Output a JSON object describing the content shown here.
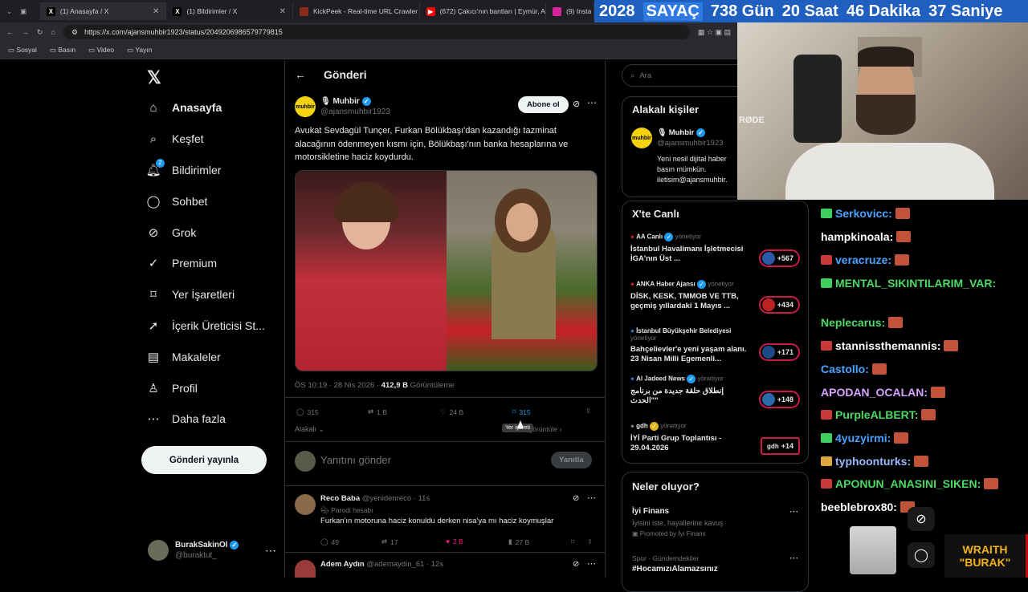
{
  "browser": {
    "tabs": [
      {
        "title": "(1) Anasayfa / X",
        "active": true
      },
      {
        "title": "(1) Bildirimler / X",
        "active": false
      },
      {
        "title": "KickPeek - Real-time URL Crawler",
        "active": false
      },
      {
        "title": "(672) Çakıcı'nın bantları | Eymür, A",
        "active": false
      },
      {
        "title": "(9) Insta",
        "active": false
      }
    ],
    "url": "https://x.com/ajansmuhbir1923/status/2049206986579779815",
    "bookmarks": [
      "Sosyal",
      "Basın",
      "Video",
      "Yayın"
    ]
  },
  "counter": {
    "year": "2028",
    "label": "SAYAÇ",
    "days": "738 Gün",
    "hours": "20 Saat",
    "minutes": "46 Dakika",
    "seconds": "37 Saniye"
  },
  "nav": {
    "items": [
      "Anasayfa",
      "Keşfet",
      "Bildirimler",
      "Sohbet",
      "Grok",
      "Premium",
      "Yer İşaretleri",
      "İçerik Üreticisi St...",
      "Makaleler",
      "Profil",
      "Daha fazla"
    ],
    "notif_badge": "2",
    "post_button": "Gönderi yayınla",
    "account_name": "BurakSakinOl",
    "account_handle": "@buraktut_"
  },
  "post": {
    "header": "Gönderi",
    "author_name": "Muhbir",
    "author_handle": "@ajansmuhbir1923",
    "subscribe": "Abone ol",
    "text": "Avukat Sevdagül Tunçer, Furkan Bölükbaşı'dan kazandığı tazminat alacağının ödenmeyen kısmı için, Bölükbaşı'nın banka hesaplarına ve motorsikletine haciz koydurdu.",
    "time": "ÖS 10:19 · 28 Nis 2026 · ",
    "views": "412,9 B",
    "views_label": "Görüntüleme",
    "replies": "315",
    "reposts": "1 B",
    "likes": "24 B",
    "bookmarks": "315",
    "tooltip": "Yer işareti",
    "relevant": "Alakalı",
    "quotes_link": "Alıntıları görüntüle",
    "reply_placeholder": "Yanıtını gönder",
    "reply_button": "Yanıtla"
  },
  "replies": [
    {
      "name": "Reco Baba",
      "handle": "@yenidenreco · 11s",
      "tag": "Parodi hesabı",
      "text": "Furkan'ın motoruna haciz konuldu derken nisa'ya mı haciz koymuşlar",
      "replies": "49",
      "reposts": "17",
      "likes": "2 B",
      "views": "27 B"
    },
    {
      "name": "Adem Aydın",
      "handle": "@ademaydin_61 · 12s"
    }
  ],
  "right": {
    "search_placeholder": "Ara",
    "people_title": "Alakalı kişiler",
    "person_name": "Muhbir",
    "person_handle": "@ajansmuhbir1923",
    "person_bio": "Yeni nesil dijital haber basın mümkün. iletisim@ajansmuhbir.",
    "live_title": "X'te Canlı",
    "live": [
      {
        "host": "AA Canlı",
        "role": "yönetiyor",
        "title": "İstanbul Havalimanı İşletmecisi İGA'nın Üst ...",
        "count": "+567"
      },
      {
        "host": "ANKA Haber Ajansı",
        "role": "yönetiyor",
        "title": "DİSK, KESK, TMMOB VE TTB, geçmiş yıllardaki 1 Mayıs ...",
        "count": "+434"
      },
      {
        "host": "İstanbul Büyükşehir Belediyesi",
        "role": "yönetiyor",
        "title": "Bahçelievler'e yeni yaşam alanı. 23 Nisan Milli Egemenli...",
        "count": "+171"
      },
      {
        "host": "Al Jadeed News",
        "role": "yönetiyor",
        "title": "إنطلاق حلقة جديدة من برنامج \"الحدث\"",
        "count": "+148"
      },
      {
        "host": "gdh",
        "role": "yönetiyor",
        "title": "İYİ Parti Grup Toplantısı - 29.04.2026",
        "count": "+14"
      }
    ],
    "happening_title": "Neler oluyor?",
    "ad_title": "İyi Finans",
    "ad_text": "İyisini iste, hayallerine kavuş",
    "ad_promo": "Promoted by İyi Finans",
    "trend_meta": "Spor · Gündemdekiler",
    "trend_tag": "#HocamızıAlamazsınız"
  },
  "chat": [
    {
      "user": "Serkovicc:",
      "color": "#4aa3ff"
    },
    {
      "user": "hampkinoala:",
      "color": "#ffffff"
    },
    {
      "user": "veracruze:",
      "color": "#4aa3ff"
    },
    {
      "user": "MENTAL_SIKINTILARIM_VAR:",
      "color": "#4cd964"
    },
    {
      "user": "Neplecarus:",
      "color": "#4cd964"
    },
    {
      "user": "stannissthemannis:",
      "color": "#ffffff"
    },
    {
      "user": "Castollo:",
      "color": "#4aa3ff"
    },
    {
      "user": "APODAN_OCALAN:",
      "color": "#d7a3ff"
    },
    {
      "user": "PurpleALBERT:",
      "color": "#4cd964"
    },
    {
      "user": "4yuzyirmi:",
      "color": "#4aa3ff"
    },
    {
      "user": "typhoonturks:",
      "color": "#9bb8ff"
    },
    {
      "user": "APONUN_ANASINI_SIKEN:",
      "color": "#4cd964"
    },
    {
      "user": "beeblebrox80:",
      "color": "#ffffff"
    }
  ],
  "overlay": {
    "brand1": "WRAITH",
    "brand2": "\"BURAK\"",
    "mic": "RØDE"
  }
}
